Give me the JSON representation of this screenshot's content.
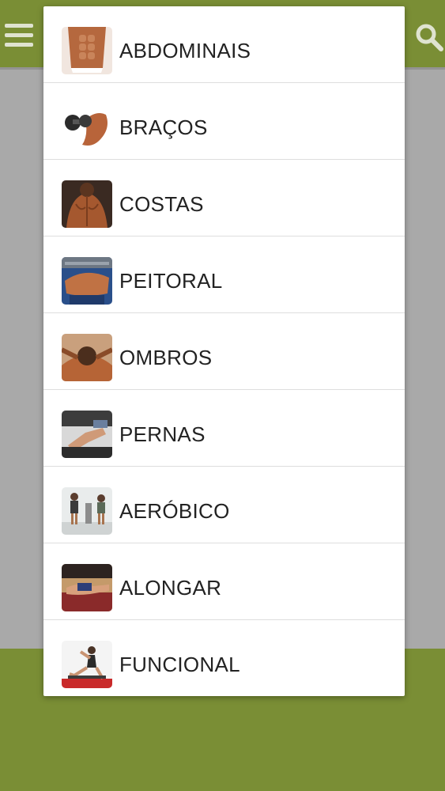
{
  "header": {
    "menu_icon": "hamburger-menu-icon",
    "search_icon": "search-icon"
  },
  "colors": {
    "bar_green": "#7a8e35",
    "overlay_gray": "#a9a9a9",
    "dialog_bg": "#ffffff",
    "text": "#222222"
  },
  "categories": [
    {
      "label": "ABDOMINAIS",
      "icon": "abs-thumbnail"
    },
    {
      "label": "BRAÇOS",
      "icon": "arms-thumbnail"
    },
    {
      "label": "COSTAS",
      "icon": "back-thumbnail"
    },
    {
      "label": "PEITORAL",
      "icon": "chest-thumbnail"
    },
    {
      "label": "OMBROS",
      "icon": "shoulders-thumbnail"
    },
    {
      "label": "PERNAS",
      "icon": "legs-thumbnail"
    },
    {
      "label": "AERÓBICO",
      "icon": "cardio-thumbnail"
    },
    {
      "label": "ALONGAR",
      "icon": "stretch-thumbnail"
    },
    {
      "label": "FUNCIONAL",
      "icon": "functional-thumbnail"
    }
  ]
}
